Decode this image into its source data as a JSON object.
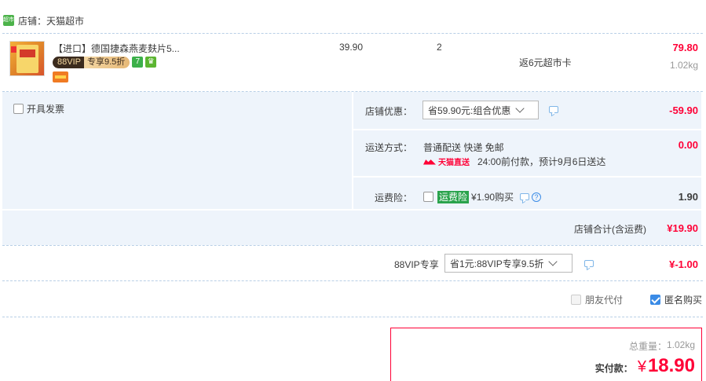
{
  "shop": {
    "icon": "超市",
    "label": "店铺：天猫超市"
  },
  "item": {
    "title": "【进口】德国捷森燕麦麸片5...",
    "vip_left": "88VIP",
    "vip_right": "专享9.5折",
    "badge_seven": "7",
    "price": "39.90",
    "quantity": "2",
    "rebate": "返6元超市卡",
    "total": "79.80",
    "weight": "1.02kg"
  },
  "invoice": {
    "label": "开具发票"
  },
  "discount": {
    "label": "店铺优惠：",
    "select": "省59.90元:组合优惠",
    "amount": "-59.90"
  },
  "shipping": {
    "label": "运送方式：",
    "method": "普通配送 快递 免邮",
    "tmall_direct": "天猫直送",
    "promise": "24:00前付款，预计9月6日送达",
    "amount": "0.00"
  },
  "insurance": {
    "label": "运费险：",
    "tag": "运费险",
    "price": "¥1.90购买",
    "amount": "1.90"
  },
  "shop_total": {
    "label": "店铺合计(含运费)",
    "amount": "¥19.90"
  },
  "vip": {
    "label": "88VIP专享",
    "select": "省1元:88VIP专享9.5折",
    "amount": "¥-1.00"
  },
  "options": {
    "friend_pay": "朋友代付",
    "anonymous": "匿名购买"
  },
  "summary": {
    "weight_label": "总重量：",
    "weight": "1.02kg",
    "pay_label": "实付款：",
    "currency": "¥",
    "pay_amount": "18.90"
  },
  "colors": {
    "accent_red": "#ff0036",
    "panel_blue": "#eef4fb",
    "tmall_green": "#4cb34a"
  }
}
